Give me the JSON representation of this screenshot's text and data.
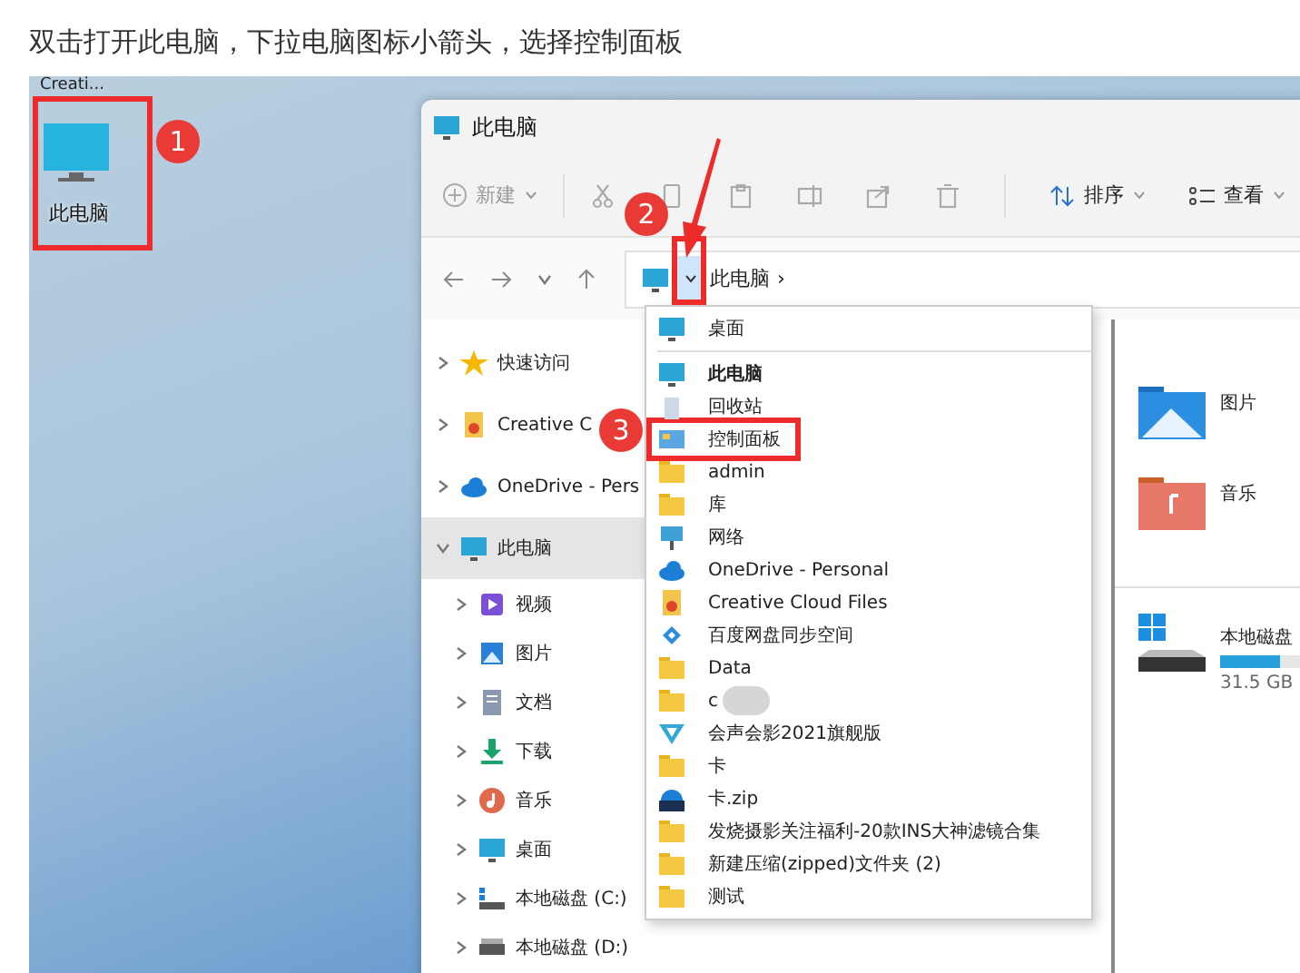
{
  "caption": "双击打开此电脑，下拉电脑图标小箭头，选择控制面板",
  "desktop": {
    "cut_label": "Creati...",
    "icon_label": "此电脑"
  },
  "window": {
    "title": "此电脑",
    "toolbar": {
      "new": "新建",
      "sort": "排序",
      "view": "查看"
    },
    "address": {
      "crumb": "此电脑",
      "separator": "›"
    },
    "nav": [
      {
        "label": "快速访问",
        "kind": "star",
        "expanded": false,
        "selected": false
      },
      {
        "label": "Creative C",
        "kind": "creative",
        "expanded": false,
        "selected": false
      },
      {
        "label": "OneDrive - Pers",
        "kind": "onedrive",
        "expanded": false,
        "selected": false
      },
      {
        "label": "此电脑",
        "kind": "pc",
        "expanded": true,
        "selected": true,
        "children": [
          {
            "label": "视频",
            "kind": "video",
            "expanded": false,
            "selected": false
          },
          {
            "label": "图片",
            "kind": "pictures",
            "expanded": false,
            "selected": false
          },
          {
            "label": "文档",
            "kind": "docs",
            "expanded": false,
            "selected": false
          },
          {
            "label": "下载",
            "kind": "download",
            "expanded": false,
            "selected": false
          },
          {
            "label": "音乐",
            "kind": "music",
            "expanded": false,
            "selected": false
          },
          {
            "label": "桌面",
            "kind": "desktop",
            "expanded": false,
            "selected": false
          },
          {
            "label": "本地磁盘 (C:)",
            "kind": "drive-c",
            "expanded": false,
            "selected": false
          },
          {
            "label": "本地磁盘 (D:)",
            "kind": "drive-d",
            "expanded": false,
            "selected": false
          }
        ]
      }
    ],
    "folders": [
      {
        "label": "图片",
        "kind": "pictures"
      },
      {
        "label": "音乐",
        "kind": "music"
      }
    ],
    "drive": {
      "label": "本地磁盘",
      "level": 0.55,
      "free": "31.5 GB"
    }
  },
  "dropdown": [
    {
      "label": "桌面",
      "kind": "desktop",
      "bold": false,
      "divider_after": true,
      "highlighted": false
    },
    {
      "label": "此电脑",
      "kind": "pc",
      "bold": true,
      "divider_after": false,
      "highlighted": false
    },
    {
      "label": "回收站",
      "kind": "recycle",
      "bold": false,
      "divider_after": false,
      "highlighted": false
    },
    {
      "label": "控制面板",
      "kind": "control",
      "bold": false,
      "divider_after": false,
      "highlighted": true
    },
    {
      "label": "admin",
      "kind": "folder",
      "bold": false,
      "divider_after": false,
      "highlighted": false
    },
    {
      "label": "库",
      "kind": "folder",
      "bold": false,
      "divider_after": false,
      "highlighted": false
    },
    {
      "label": "网络",
      "kind": "network",
      "bold": false,
      "divider_after": false,
      "highlighted": false
    },
    {
      "label": "OneDrive - Personal",
      "kind": "onedrive",
      "bold": false,
      "divider_after": false,
      "highlighted": false
    },
    {
      "label": "Creative Cloud Files",
      "kind": "creative",
      "bold": false,
      "divider_after": false,
      "highlighted": false
    },
    {
      "label": "百度网盘同步空间",
      "kind": "baidu",
      "bold": false,
      "divider_after": false,
      "highlighted": false
    },
    {
      "label": "Data",
      "kind": "folder",
      "bold": false,
      "divider_after": false,
      "highlighted": false
    },
    {
      "label": "c",
      "kind": "folder",
      "bold": false,
      "divider_after": false,
      "highlighted": false,
      "redacted": true
    },
    {
      "label": "会声会影2021旗舰版",
      "kind": "editor",
      "bold": false,
      "divider_after": false,
      "highlighted": false
    },
    {
      "label": "卡",
      "kind": "folder",
      "bold": false,
      "divider_after": false,
      "highlighted": false
    },
    {
      "label": "卡.zip",
      "kind": "zip",
      "bold": false,
      "divider_after": false,
      "highlighted": false
    },
    {
      "label": "发烧摄影关注福利-20款INS大神滤镜合集",
      "kind": "folder",
      "bold": false,
      "divider_after": false,
      "highlighted": false
    },
    {
      "label": "新建压缩(zipped)文件夹 (2)",
      "kind": "folder",
      "bold": false,
      "divider_after": false,
      "highlighted": false
    },
    {
      "label": "测试",
      "kind": "folder",
      "bold": false,
      "divider_after": false,
      "highlighted": false
    }
  ],
  "markers": [
    {
      "label": "1"
    },
    {
      "label": "2"
    },
    {
      "label": "3"
    }
  ]
}
